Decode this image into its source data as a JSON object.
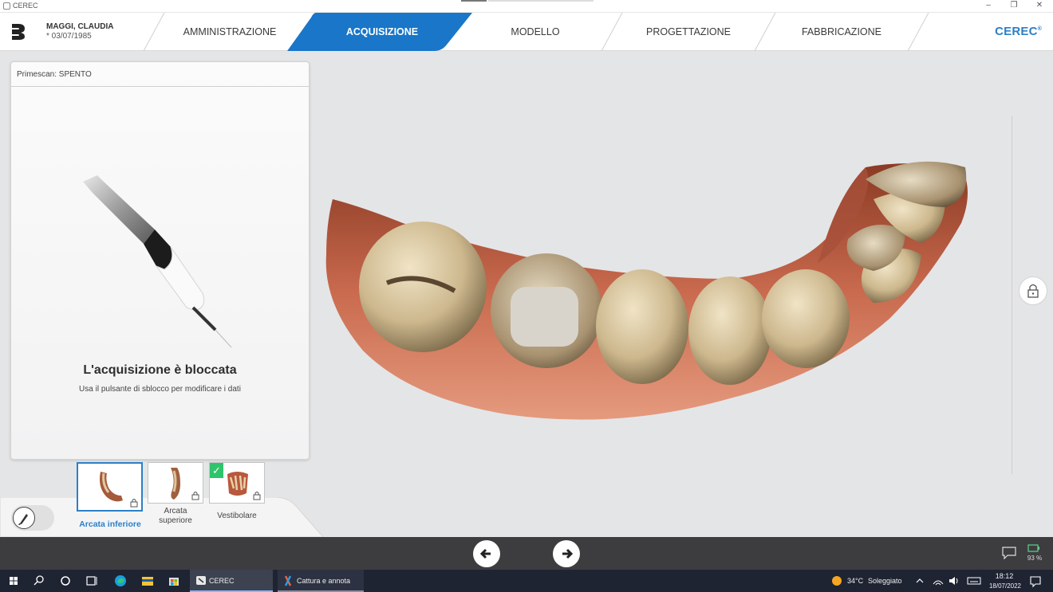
{
  "window": {
    "title": "CEREC",
    "controls": [
      "–",
      "❐",
      "✕"
    ]
  },
  "patient": {
    "name": "MAGGI, CLAUDIA",
    "dob": "* 03/07/1985"
  },
  "workflow_steps": [
    {
      "label": "AMMINISTRAZIONE",
      "active": false
    },
    {
      "label": "ACQUISIZIONE",
      "active": true
    },
    {
      "label": "MODELLO",
      "active": false
    },
    {
      "label": "PROGETTAZIONE",
      "active": false
    },
    {
      "label": "FABBRICAZIONE",
      "active": false
    }
  ],
  "brand": {
    "name": "CEREC",
    "mark": "®"
  },
  "colors": {
    "accent": "#2d7fc6",
    "check": "#2ec46b",
    "navbar": "#3d3d40",
    "taskbar": "#1f2433"
  },
  "left_panel": {
    "scanner_status": "Primescan: SPENTO",
    "locked_title": "L'acquisizione è bloccata",
    "locked_subtitle": "Usa il pulsante di sblocco per modificare i dati"
  },
  "scan_catalogs": [
    {
      "label": "Arcata inferiore",
      "selected": true,
      "locked": true,
      "checked": false
    },
    {
      "label": "Arcata superiore",
      "selected": false,
      "locked": true,
      "checked": false
    },
    {
      "label": "Vestibolare",
      "selected": false,
      "locked": true,
      "checked": true
    }
  ],
  "status": {
    "battery": "93 %"
  },
  "taskbar": {
    "apps": [
      {
        "label": "CEREC",
        "active": true
      },
      {
        "label": "Cattura e annota",
        "active": false
      }
    ],
    "weather": {
      "temp": "34°C",
      "condition": "Soleggiato"
    },
    "time": "18:12",
    "date": "18/07/2022"
  }
}
